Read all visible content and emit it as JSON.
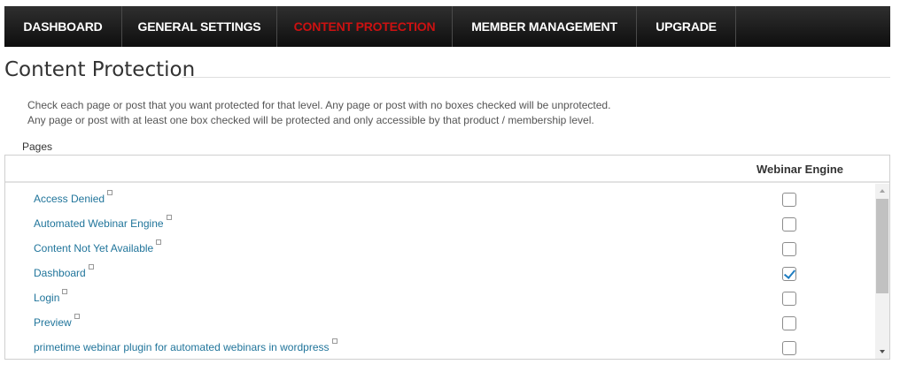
{
  "nav": {
    "tabs": [
      {
        "label": "DASHBOARD"
      },
      {
        "label": "GENERAL SETTINGS"
      },
      {
        "label": "CONTENT PROTECTION"
      },
      {
        "label": "MEMBER MANAGEMENT"
      },
      {
        "label": "UPGRADE"
      }
    ],
    "active_color": "#cc1111"
  },
  "page_title": "Content Protection",
  "description": {
    "line1": "Check each page or post that you want protected for that level. Any page or post with no boxes checked will be unprotected.",
    "line2": "Any page or post with at least one box checked will be protected and only accessible by that product / membership level."
  },
  "pages_label": "Pages",
  "table": {
    "column_header": "Webinar Engine",
    "rows": [
      {
        "title": "Access Denied",
        "checked": false
      },
      {
        "title": "Automated Webinar Engine",
        "checked": false
      },
      {
        "title": "Content Not Yet Available",
        "checked": false
      },
      {
        "title": "Dashboard",
        "checked": true
      },
      {
        "title": "Login",
        "checked": false
      },
      {
        "title": "Preview",
        "checked": false
      },
      {
        "title": "primetime webinar plugin for automated webinars in wordpress",
        "checked": false
      }
    ]
  },
  "icons": {
    "external_link": "external-link-icon",
    "scroll_up": "scroll-up-arrow-icon",
    "scroll_down": "scroll-down-arrow-icon",
    "check": "checkmark-icon"
  },
  "colors": {
    "link": "#21759b",
    "check": "#1e7cc0",
    "nav_bg": "#1a1a1a"
  }
}
